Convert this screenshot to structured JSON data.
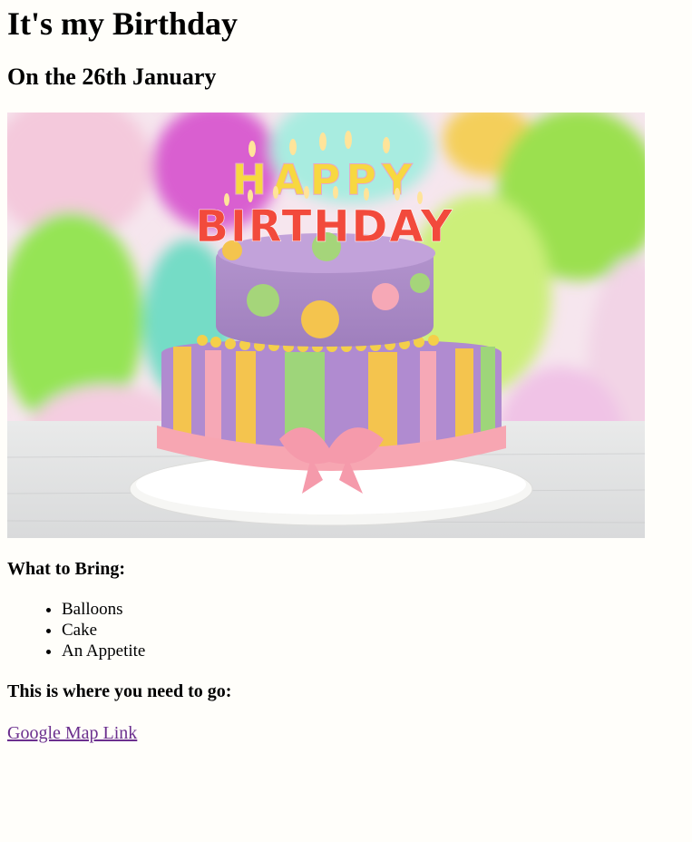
{
  "header": {
    "title": "It's my Birthday",
    "subtitle": "On the 26th January"
  },
  "hero_image": {
    "icon": "birthday-cake-image",
    "topper_line1": "HAPPY",
    "topper_line2": "BIRTHDAY"
  },
  "bring": {
    "heading": "What to Bring:",
    "items": [
      "Balloons",
      "Cake",
      "An Appetite"
    ]
  },
  "location": {
    "heading": "This is where you need to go:",
    "link_text": "Google Map Link"
  },
  "colors": {
    "background": "#fffefa",
    "link_visited": "#6b2f8e"
  }
}
